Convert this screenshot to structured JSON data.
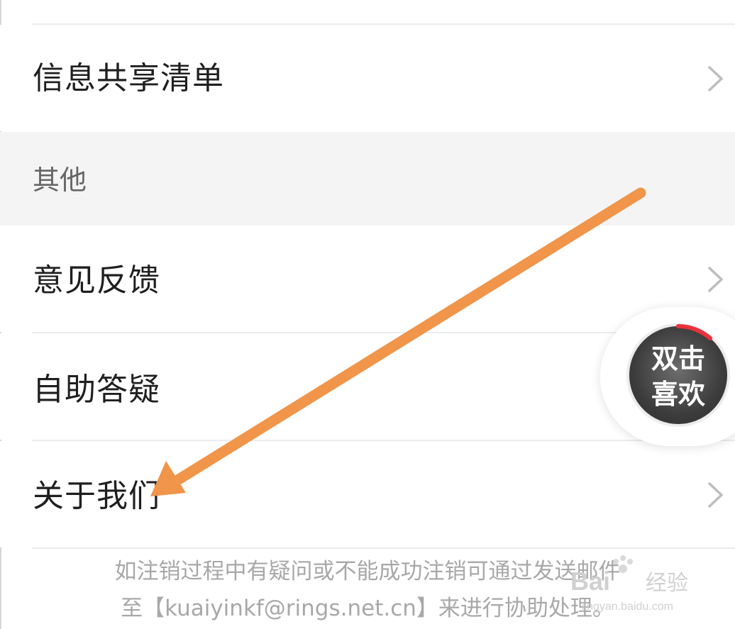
{
  "rows": {
    "share_list": "信息共享清单",
    "feedback": "意见反馈",
    "self_help": "自助答疑",
    "about_us": "关于我们"
  },
  "section": {
    "other_label": "其他"
  },
  "footer": {
    "line1": "如注销过程中有疑问或不能成功注销可通过发送邮件",
    "line2": "至【kuaiyinkf@rings.net.cn】来进行协助处理。"
  },
  "float_button": {
    "line1": "双击",
    "line2": "喜欢"
  },
  "watermark": {
    "brand": "Bai",
    "brand_suffix": "经验",
    "url": "jingyan.baidu.com"
  },
  "colors": {
    "arrow": "#f0954a",
    "ring_accent": "#e8323c"
  }
}
